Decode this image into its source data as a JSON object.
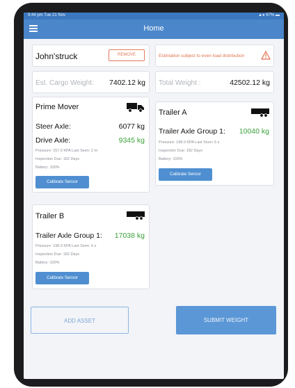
{
  "status_bar": {
    "left": "9:44 pm  Tue 21 Nov",
    "right": "▲● 67% ▬"
  },
  "nav": {
    "title": "Home"
  },
  "vehicle": {
    "name": "John'struck",
    "remove_label": "REMOVE"
  },
  "warning": {
    "text": "Estimation subject to even load distribution"
  },
  "cargo": {
    "label": "Est. Cargo Weight:",
    "value": "7402.12 kg"
  },
  "total": {
    "label": "Total Weight :",
    "value": "42502.12 kg"
  },
  "prime_mover": {
    "title": "Prime Mover",
    "steer_label": "Steer Axle:",
    "steer_value": "6077 kg",
    "drive_label": "Drive Axle:",
    "drive_value": "9345 kg",
    "pressure": "Pressure: 157.0 KPA   Last Seen: 2 m",
    "inspection": "Inspection Due: 182 Days",
    "battery": "Battery: 100%",
    "calibrate": "Calibrate Sensor"
  },
  "trailer_a": {
    "title": "Trailer A",
    "group_label": "Trailer Axle Group 1:",
    "group_value": "10040 kg",
    "pressure": "Pressure: 198.0 KPA   Last Seen: 6 s",
    "inspection": "Inspection Due: 182 Days",
    "battery": "Battery: 100%",
    "calibrate": "Calibrate Sensor"
  },
  "trailer_b": {
    "title": "Trailer B",
    "group_label": "Trailer Axle Group 1:",
    "group_value": "17038 kg",
    "pressure": "Pressure: 198.0 KPA   Last Seen: 6 s",
    "inspection": "Inspection Due: 182 Days",
    "battery": "Battery: 100%",
    "calibrate": "Calibrate Sensor"
  },
  "actions": {
    "add_asset": "ADD ASSET",
    "submit_weight": "SUBMIT WEIGHT"
  },
  "colors": {
    "nav": "#4a86c9",
    "accent_green": "#3aa23a",
    "warning": "#e0724f",
    "button": "#4f8fd1"
  },
  "icons": [
    "menu-icon",
    "warning-icon",
    "truck-icon",
    "trailer-icon"
  ]
}
